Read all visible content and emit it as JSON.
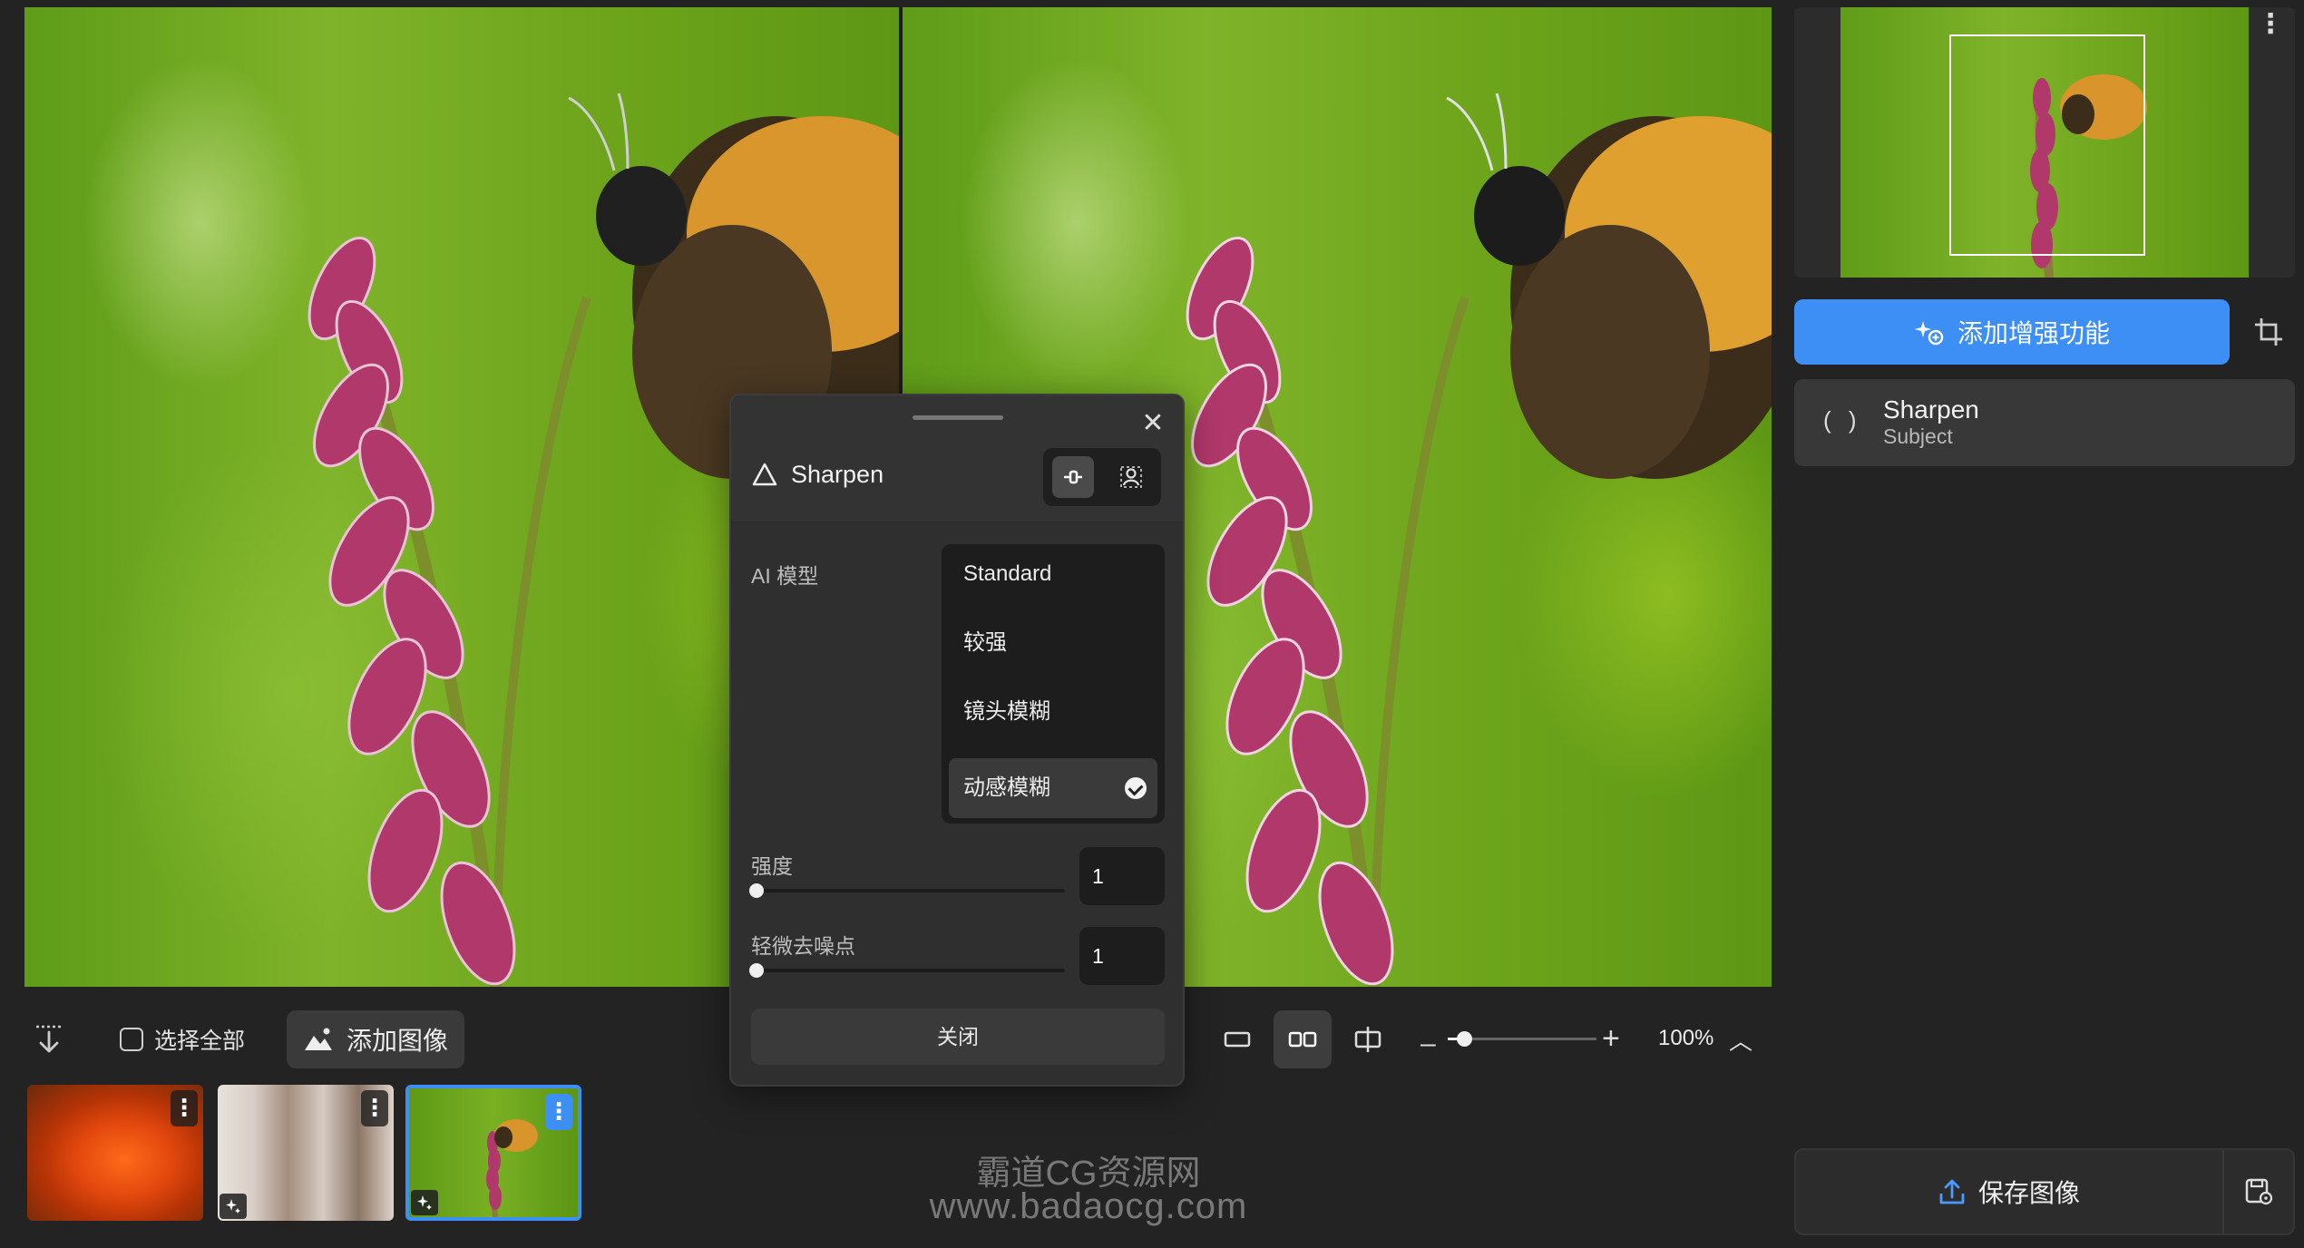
{
  "panel": {
    "title": "Sharpen",
    "model_label": "AI 模型",
    "models": [
      "Standard",
      "较强",
      "镜头模糊",
      "动感模糊"
    ],
    "selected_model": "动感模糊",
    "strength_label": "强度",
    "strength_value": "1",
    "denoise_label": "轻微去噪点",
    "denoise_value": "1",
    "close_label": "关闭"
  },
  "toolbar": {
    "select_all_label": "选择全部",
    "add_image_label": "添加图像",
    "zoom_level": "100%"
  },
  "sidebar": {
    "add_enhancement_label": "添加增强功能",
    "enhancement": {
      "title": "Sharpen",
      "subtitle": "Subject",
      "paren": "( )"
    },
    "save_label": "保存图像"
  },
  "thumbnails": {
    "more_glyph": "⋮"
  },
  "watermark": {
    "line1": "霸道CG资源网",
    "line2": "www.badaocg.com"
  },
  "colors": {
    "accent": "#3d8ff5",
    "background": "#232323",
    "panel": "#2f2f2f"
  }
}
